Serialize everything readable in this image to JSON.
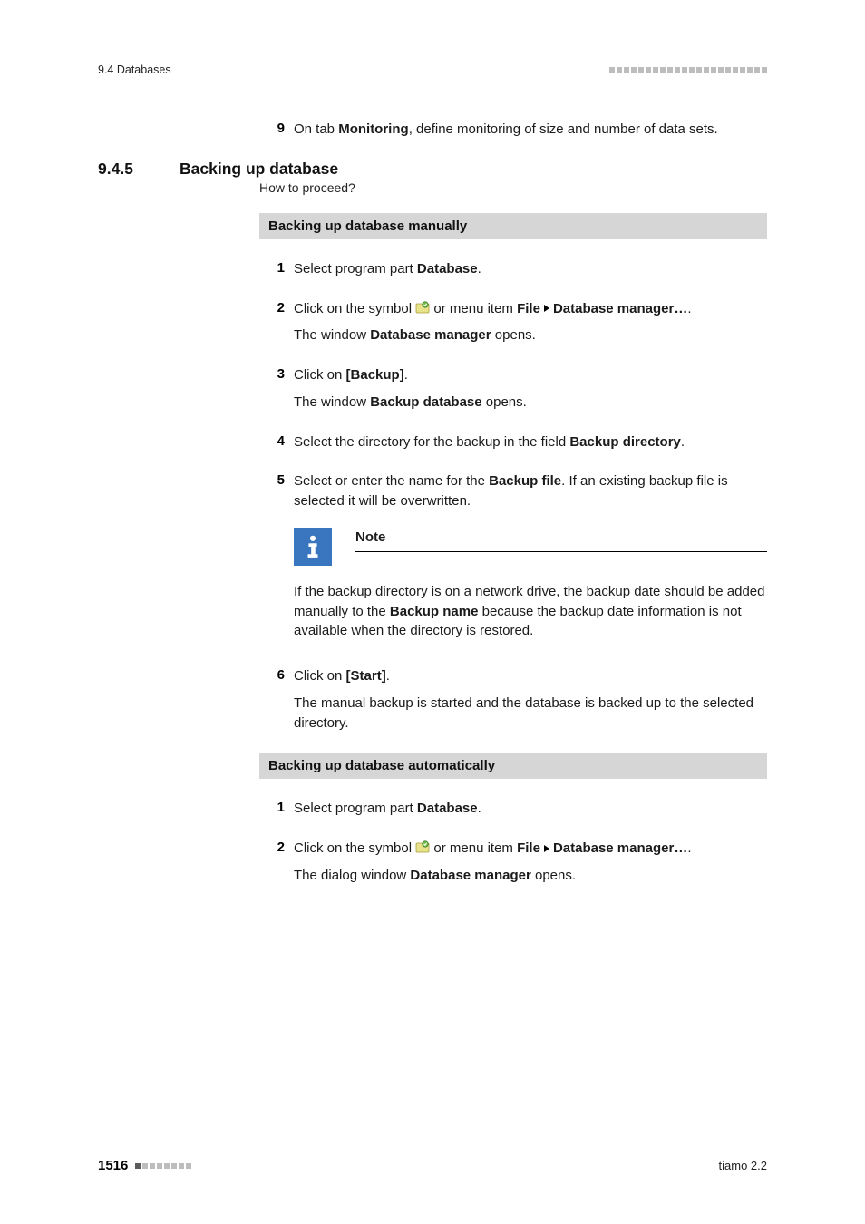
{
  "header": {
    "left": "9.4 Databases"
  },
  "preStep": {
    "num": "9",
    "line1_a": "On tab ",
    "line1_b": "Monitoring",
    "line1_c": ", define monitoring of size and number of data sets."
  },
  "section": {
    "num": "9.4.5",
    "title": "Backing up database",
    "howTo": "How to proceed?"
  },
  "manual": {
    "bar": "Backing up database manually",
    "s1": {
      "num": "1",
      "a": "Select program part ",
      "b": "Database",
      "c": "."
    },
    "s2": {
      "num": "2",
      "a": "Click on the symbol ",
      "b": " or menu item ",
      "file": "File",
      "dm": "Database manager…",
      "dot": ".",
      "l2a": "The window ",
      "l2b": "Database manager",
      "l2c": " opens."
    },
    "s3": {
      "num": "3",
      "a": "Click on ",
      "b": "[Backup]",
      "c": ".",
      "l2a": "The window ",
      "l2b": "Backup database",
      "l2c": " opens."
    },
    "s4": {
      "num": "4",
      "a": "Select the directory for the backup in the field ",
      "b": "Backup directory",
      "c": "."
    },
    "s5": {
      "num": "5",
      "a": "Select or enter the name for the ",
      "b": "Backup file",
      "c": ". If an existing backup file is selected it will be overwritten."
    },
    "note": {
      "title": "Note",
      "t1": "If the backup directory is on a network drive, the backup date should be added manually to the ",
      "t2": "Backup name",
      "t3": " because the backup date information is not available when the directory is restored."
    },
    "s6": {
      "num": "6",
      "a": "Click on ",
      "b": "[Start]",
      "c": ".",
      "l2": "The manual backup is started and the database is backed up to the selected directory."
    }
  },
  "auto": {
    "bar": "Backing up database automatically",
    "s1": {
      "num": "1",
      "a": "Select program part ",
      "b": "Database",
      "c": "."
    },
    "s2": {
      "num": "2",
      "a": "Click on the symbol ",
      "b": " or menu item ",
      "file": "File",
      "dm": "Database manager…",
      "dot": ".",
      "l2a": "The dialog window ",
      "l2b": "Database manager",
      "l2c": " opens."
    }
  },
  "footer": {
    "page": "1516",
    "right": "tiamo 2.2"
  }
}
